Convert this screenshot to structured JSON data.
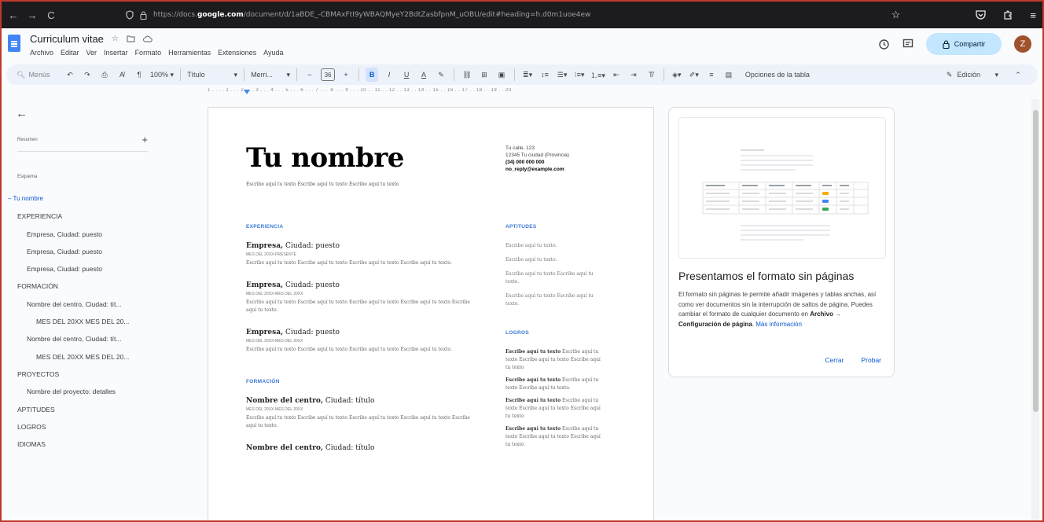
{
  "browser": {
    "back_icon": "←",
    "forward_icon": "→",
    "reload_icon": "C",
    "url_prefix": "https://docs.",
    "url_domain": "google.com",
    "url_suffix": "/document/d/1aBDE_-CBMAxFtI9yWBAQMyeY2BdtZasbfpnM_uOBU/edit#heading=h.d0m1uoe4ew"
  },
  "docs": {
    "title": "Curriculum vitae",
    "menu": [
      "Archivo",
      "Editar",
      "Ver",
      "Insertar",
      "Formato",
      "Herramientas",
      "Extensiones",
      "Ayuda"
    ],
    "share_label": "Compartir",
    "avatar_letter": "Z",
    "accent": "#c2e7ff"
  },
  "toolbar": {
    "search_label": "Menús",
    "zoom": "100%",
    "style": "Título",
    "font": "Merri...",
    "font_size": "36",
    "table_options": "Opciones de la tabla",
    "mode": "Edición"
  },
  "ruler": {
    "ticks": "1 . . . . 1 . . . 2 . . . 3 . . . 4 . . . 5 . . . 6 . . . 7 . . . 8 . . . 9 . . . 10 . . 11 . . 12 . . 13 . . 14 . . 15 . . 16 . . 17 . . 18 . . 19 . . 20"
  },
  "outline": {
    "summary_label": "Resumen",
    "heading_label": "Esquema",
    "items": [
      {
        "label": "Tu nombre",
        "level": "active"
      },
      {
        "label": "EXPERIENCIA",
        "level": "l1"
      },
      {
        "label": "Empresa, Ciudad: puesto",
        "level": "l2"
      },
      {
        "label": "Empresa, Ciudad: puesto",
        "level": "l2"
      },
      {
        "label": "Empresa, Ciudad: puesto",
        "level": "l2"
      },
      {
        "label": "FORMACIÓN",
        "level": "l1"
      },
      {
        "label": "Nombre del centro, Ciudad: tít...",
        "level": "l2"
      },
      {
        "label": "MES DEL 20XX MES DEL 20...",
        "level": "l3"
      },
      {
        "label": "Nombre del centro, Ciudad: tít...",
        "level": "l2"
      },
      {
        "label": "MES DEL 20XX MES DEL 20...",
        "level": "l3"
      },
      {
        "label": "PROYECTOS",
        "level": "l1"
      },
      {
        "label": "Nombre del proyecto: detalles",
        "level": "l2"
      },
      {
        "label": "APTITUDES",
        "level": "l1"
      },
      {
        "label": "LOGROS",
        "level": "l1"
      },
      {
        "label": "IDIOMAS",
        "level": "l1"
      }
    ]
  },
  "cv": {
    "name": "Tu nombre",
    "intro": "Escribe aquí tu texto Escribe aquí tu texto Escribe aquí tu texto",
    "contact": {
      "street": "Tu calle, 123",
      "city": "12345 Tu ciudad (Provincia)",
      "phone": "(34) 000 000 000",
      "email": "no_reply@example.com"
    },
    "experience_heading": "EXPERIENCIA",
    "jobs": [
      {
        "company": "Empresa,",
        "rest": " Ciudad: puesto",
        "date": "MES DEL 20XX-PRESENTE",
        "desc": "Escribe aquí tu texto Escribe aquí tu texto Escribe aquí tu texto Escribe aquí tu texto."
      },
      {
        "company": "Empresa,",
        "rest": " Ciudad: puesto",
        "date": "MES DEL 20XX-MES DEL 20XX",
        "desc": "Escribe aquí tu texto Escribe aquí tu texto Escribe aquí tu texto Escribe aquí tu texto Escribe aquí tu texto."
      },
      {
        "company": "Empresa,",
        "rest": " Ciudad: puesto",
        "date": "MES DEL 20XX-MES DEL 20XX",
        "desc": "Escribe aquí tu texto Escribe aquí tu texto Escribe aquí tu texto Escribe aquí tu texto."
      }
    ],
    "education_heading": "FORMACIÓN",
    "schools": [
      {
        "company": "Nombre del centro,",
        "rest": " Ciudad: título",
        "date": "MES DEL 20XX-MES DEL 20XX",
        "desc": "Escribe aquí tu texto Escribe aquí tu texto Escribe aquí tu texto Escribe aquí tu texto Escribe aquí tu texto."
      },
      {
        "company": "Nombre del centro,",
        "rest": " Ciudad: título"
      }
    ],
    "skills_heading": "APTITUDES",
    "skills": [
      "Escribe aquí tu texto.",
      "Escribe aquí tu texto.",
      "Escribe aquí tu texto Escribe aquí tu texto.",
      "Escribe aquí tu texto Escribe aquí tu texto."
    ],
    "achievements_heading": "LOGROS",
    "achievements": [
      {
        "bold": "Escribe aquí tu texto",
        "text": " Escribe aquí tu texto Escribe aquí tu texto Escribe aquí tu texto"
      },
      {
        "bold": "Escribe aquí tu texto",
        "text": " Escribe aquí tu texto Escribe aquí tu texto."
      },
      {
        "bold": "Escribe aquí tu texto",
        "text": " Escribe aquí tu texto Escribe aquí tu texto Escribe aquí tu texto"
      },
      {
        "bold": "Escribe aquí tu texto",
        "text": " Escribe aquí tu texto Escribe aquí tu texto Escribe aquí tu texto"
      }
    ]
  },
  "promo": {
    "title": "Presentamos el formato sin páginas",
    "body_1": "El formato sin páginas te permite añadir imágenes y tablas anchas, así como ver documentos sin la interrupción de saltos de página. Puedes cambiar el formato de cualquier documento en ",
    "body_bold_1": "Archivo",
    "body_arrow": " → ",
    "body_bold_2": "Configuración de página",
    "body_2": ". ",
    "body_link": "Más información",
    "close_label": "Cerrar",
    "try_label": "Probar"
  }
}
